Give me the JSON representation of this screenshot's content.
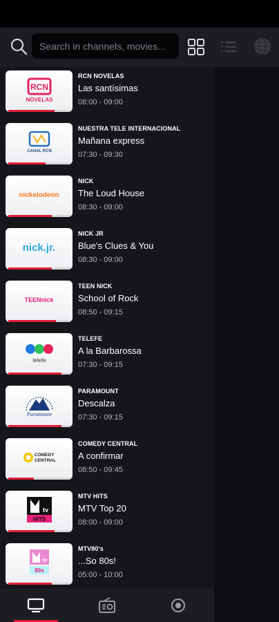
{
  "search": {
    "placeholder": "Search in channels, movies..."
  },
  "channels": [
    {
      "channel": "RCN NOVELAS",
      "title": "Las santísimas",
      "time": "08:00 - 09:00",
      "progress": 0.72,
      "logo": "rcn-novelas-logo",
      "logo_text": "NOVELAS"
    },
    {
      "channel": "NUESTRA TELE INTERNACIONAL",
      "title": "Mañana express",
      "time": "07:30 - 09:30",
      "progress": 0.58,
      "logo": "canal-rcn-logo",
      "logo_text": "CANAL RCN"
    },
    {
      "channel": "NICK",
      "title": "The Loud House",
      "time": "08:30 - 09:00",
      "progress": 0.68,
      "logo": "nickelodeon-logo",
      "logo_text": "nickelodeon"
    },
    {
      "channel": "NICK JR",
      "title": "Blue's Clues & You",
      "time": "08:30 - 09:00",
      "progress": 0.68,
      "logo": "nick-jr-logo",
      "logo_text": "nick.jr."
    },
    {
      "channel": "TEEN NICK",
      "title": "School of Rock",
      "time": "08:50 - 09:15",
      "progress": 0.74,
      "logo": "teen-nick-logo",
      "logo_text": "TEENnick"
    },
    {
      "channel": "TELEFE",
      "title": "A la Barbarossa",
      "time": "07:30 - 09:15",
      "progress": 0.83,
      "logo": "telefe-logo",
      "logo_text": "telefe"
    },
    {
      "channel": "PARAMOUNT",
      "title": "Descalza",
      "time": "07:30 - 09:15",
      "progress": 0.83,
      "logo": "paramount-logo",
      "logo_text": "Paramount"
    },
    {
      "channel": "COMEDY CENTRAL",
      "title": "A confirmar",
      "time": "08:50 - 09:45",
      "progress": 0.4,
      "logo": "comedy-central-logo",
      "logo_text": "COMEDY CENTRAL"
    },
    {
      "channel": "MTV HITS",
      "title": "MTV Top 20",
      "time": "08:00 - 09:00",
      "progress": 0.72,
      "logo": "mtv-hits-logo",
      "logo_text": "HITS"
    },
    {
      "channel": "MTV80's",
      "title": "...So 80s!",
      "time": "05:00 - 10:00",
      "progress": 0.68,
      "logo": "mtv-80s-logo",
      "logo_text": "80s"
    }
  ],
  "bottom_nav": [
    {
      "icon": "tv-icon",
      "active": true
    },
    {
      "icon": "radio-icon",
      "active": false
    },
    {
      "icon": "record-icon",
      "active": false
    }
  ],
  "colors": {
    "accent": "#e11e38",
    "panel": "#15161a",
    "header": "#1c1d22"
  }
}
